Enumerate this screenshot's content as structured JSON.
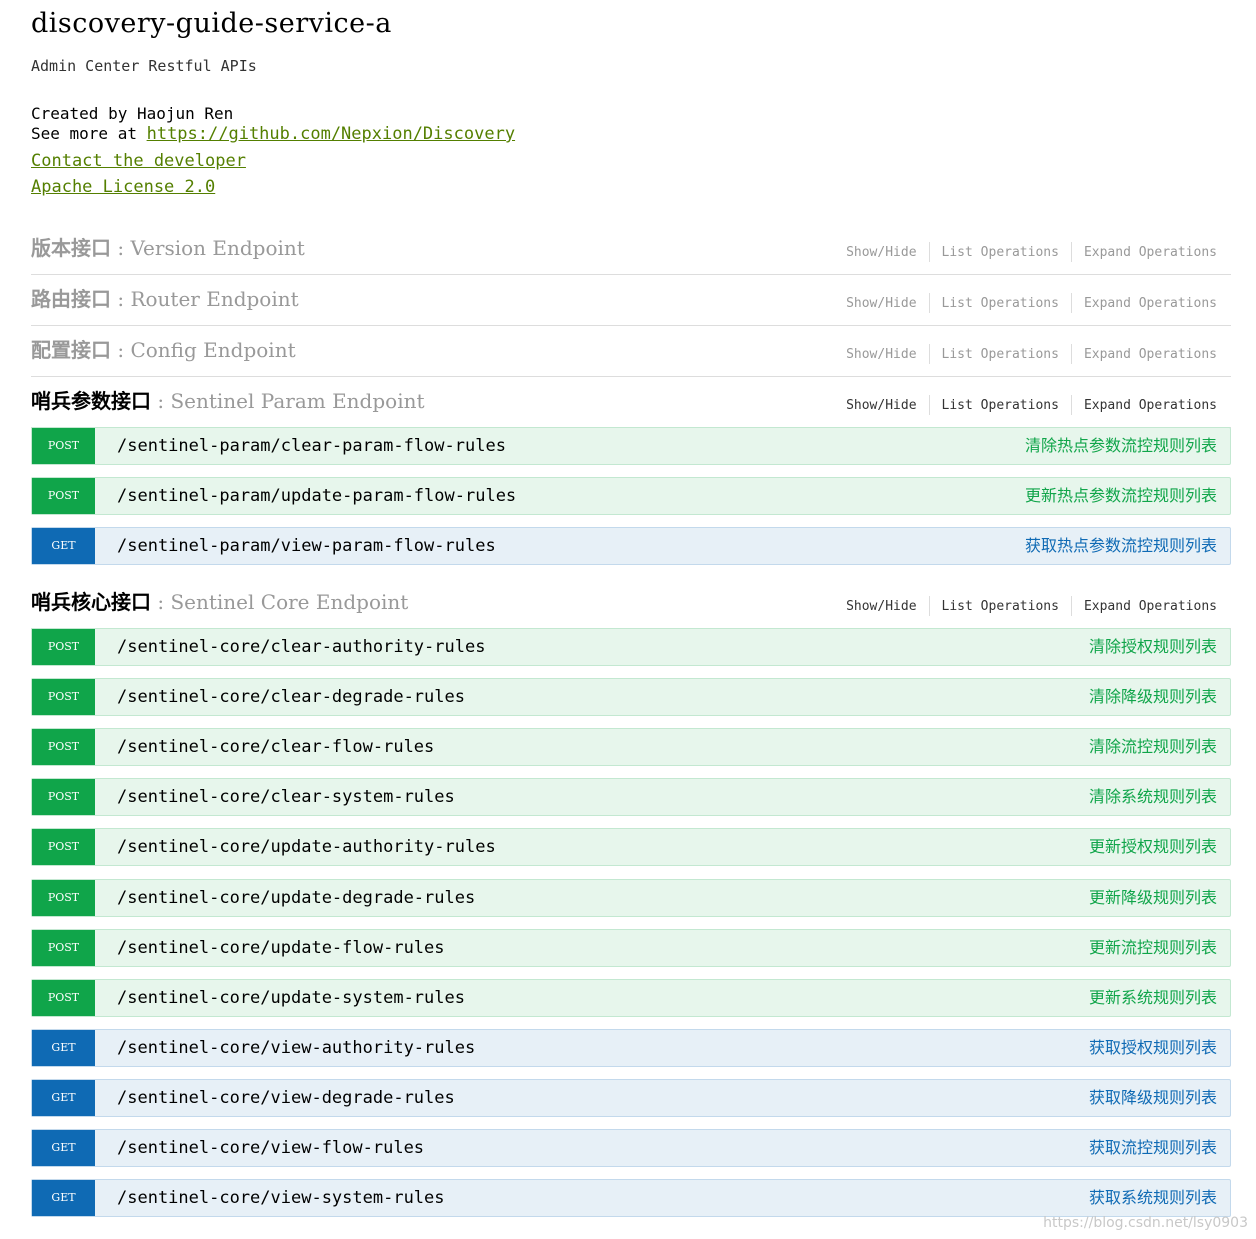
{
  "info": {
    "title": "discovery-guide-service-a",
    "description": "Admin Center Restful APIs",
    "created_by": "Created by Haojun Ren",
    "see_more_prefix": "See more at ",
    "see_more_link": "https://github.com/Nepxion/Discovery",
    "contact_link": "Contact the developer",
    "license_link": "Apache License 2.0"
  },
  "controls": {
    "show_hide": "Show/Hide",
    "list_operations": "List Operations",
    "expand_operations": "Expand Operations"
  },
  "endpoints": [
    {
      "cn": "版本接口",
      "sep": " : ",
      "en": "Version Endpoint"
    },
    {
      "cn": "路由接口",
      "sep": " : ",
      "en": "Router Endpoint"
    },
    {
      "cn": "配置接口",
      "sep": " : ",
      "en": "Config Endpoint"
    },
    {
      "cn": "哨兵参数接口",
      "sep": " : ",
      "en": "Sentinel Param Endpoint",
      "operations": [
        {
          "method": "POST",
          "path": "/sentinel-param/clear-param-flow-rules",
          "summary": "清除热点参数流控规则列表"
        },
        {
          "method": "POST",
          "path": "/sentinel-param/update-param-flow-rules",
          "summary": "更新热点参数流控规则列表"
        },
        {
          "method": "GET",
          "path": "/sentinel-param/view-param-flow-rules",
          "summary": "获取热点参数流控规则列表"
        }
      ]
    },
    {
      "cn": "哨兵核心接口",
      "sep": " : ",
      "en": "Sentinel Core Endpoint",
      "operations": [
        {
          "method": "POST",
          "path": "/sentinel-core/clear-authority-rules",
          "summary": "清除授权规则列表"
        },
        {
          "method": "POST",
          "path": "/sentinel-core/clear-degrade-rules",
          "summary": "清除降级规则列表"
        },
        {
          "method": "POST",
          "path": "/sentinel-core/clear-flow-rules",
          "summary": "清除流控规则列表"
        },
        {
          "method": "POST",
          "path": "/sentinel-core/clear-system-rules",
          "summary": "清除系统规则列表"
        },
        {
          "method": "POST",
          "path": "/sentinel-core/update-authority-rules",
          "summary": "更新授权规则列表"
        },
        {
          "method": "POST",
          "path": "/sentinel-core/update-degrade-rules",
          "summary": "更新降级规则列表"
        },
        {
          "method": "POST",
          "path": "/sentinel-core/update-flow-rules",
          "summary": "更新流控规则列表"
        },
        {
          "method": "POST",
          "path": "/sentinel-core/update-system-rules",
          "summary": "更新系统规则列表"
        },
        {
          "method": "GET",
          "path": "/sentinel-core/view-authority-rules",
          "summary": "获取授权规则列表"
        },
        {
          "method": "GET",
          "path": "/sentinel-core/view-degrade-rules",
          "summary": "获取降级规则列表"
        },
        {
          "method": "GET",
          "path": "/sentinel-core/view-flow-rules",
          "summary": "获取流控规则列表"
        },
        {
          "method": "GET",
          "path": "/sentinel-core/view-system-rules",
          "summary": "获取系统规则列表"
        }
      ]
    }
  ],
  "watermark": "https://blog.csdn.net/lsy0903"
}
